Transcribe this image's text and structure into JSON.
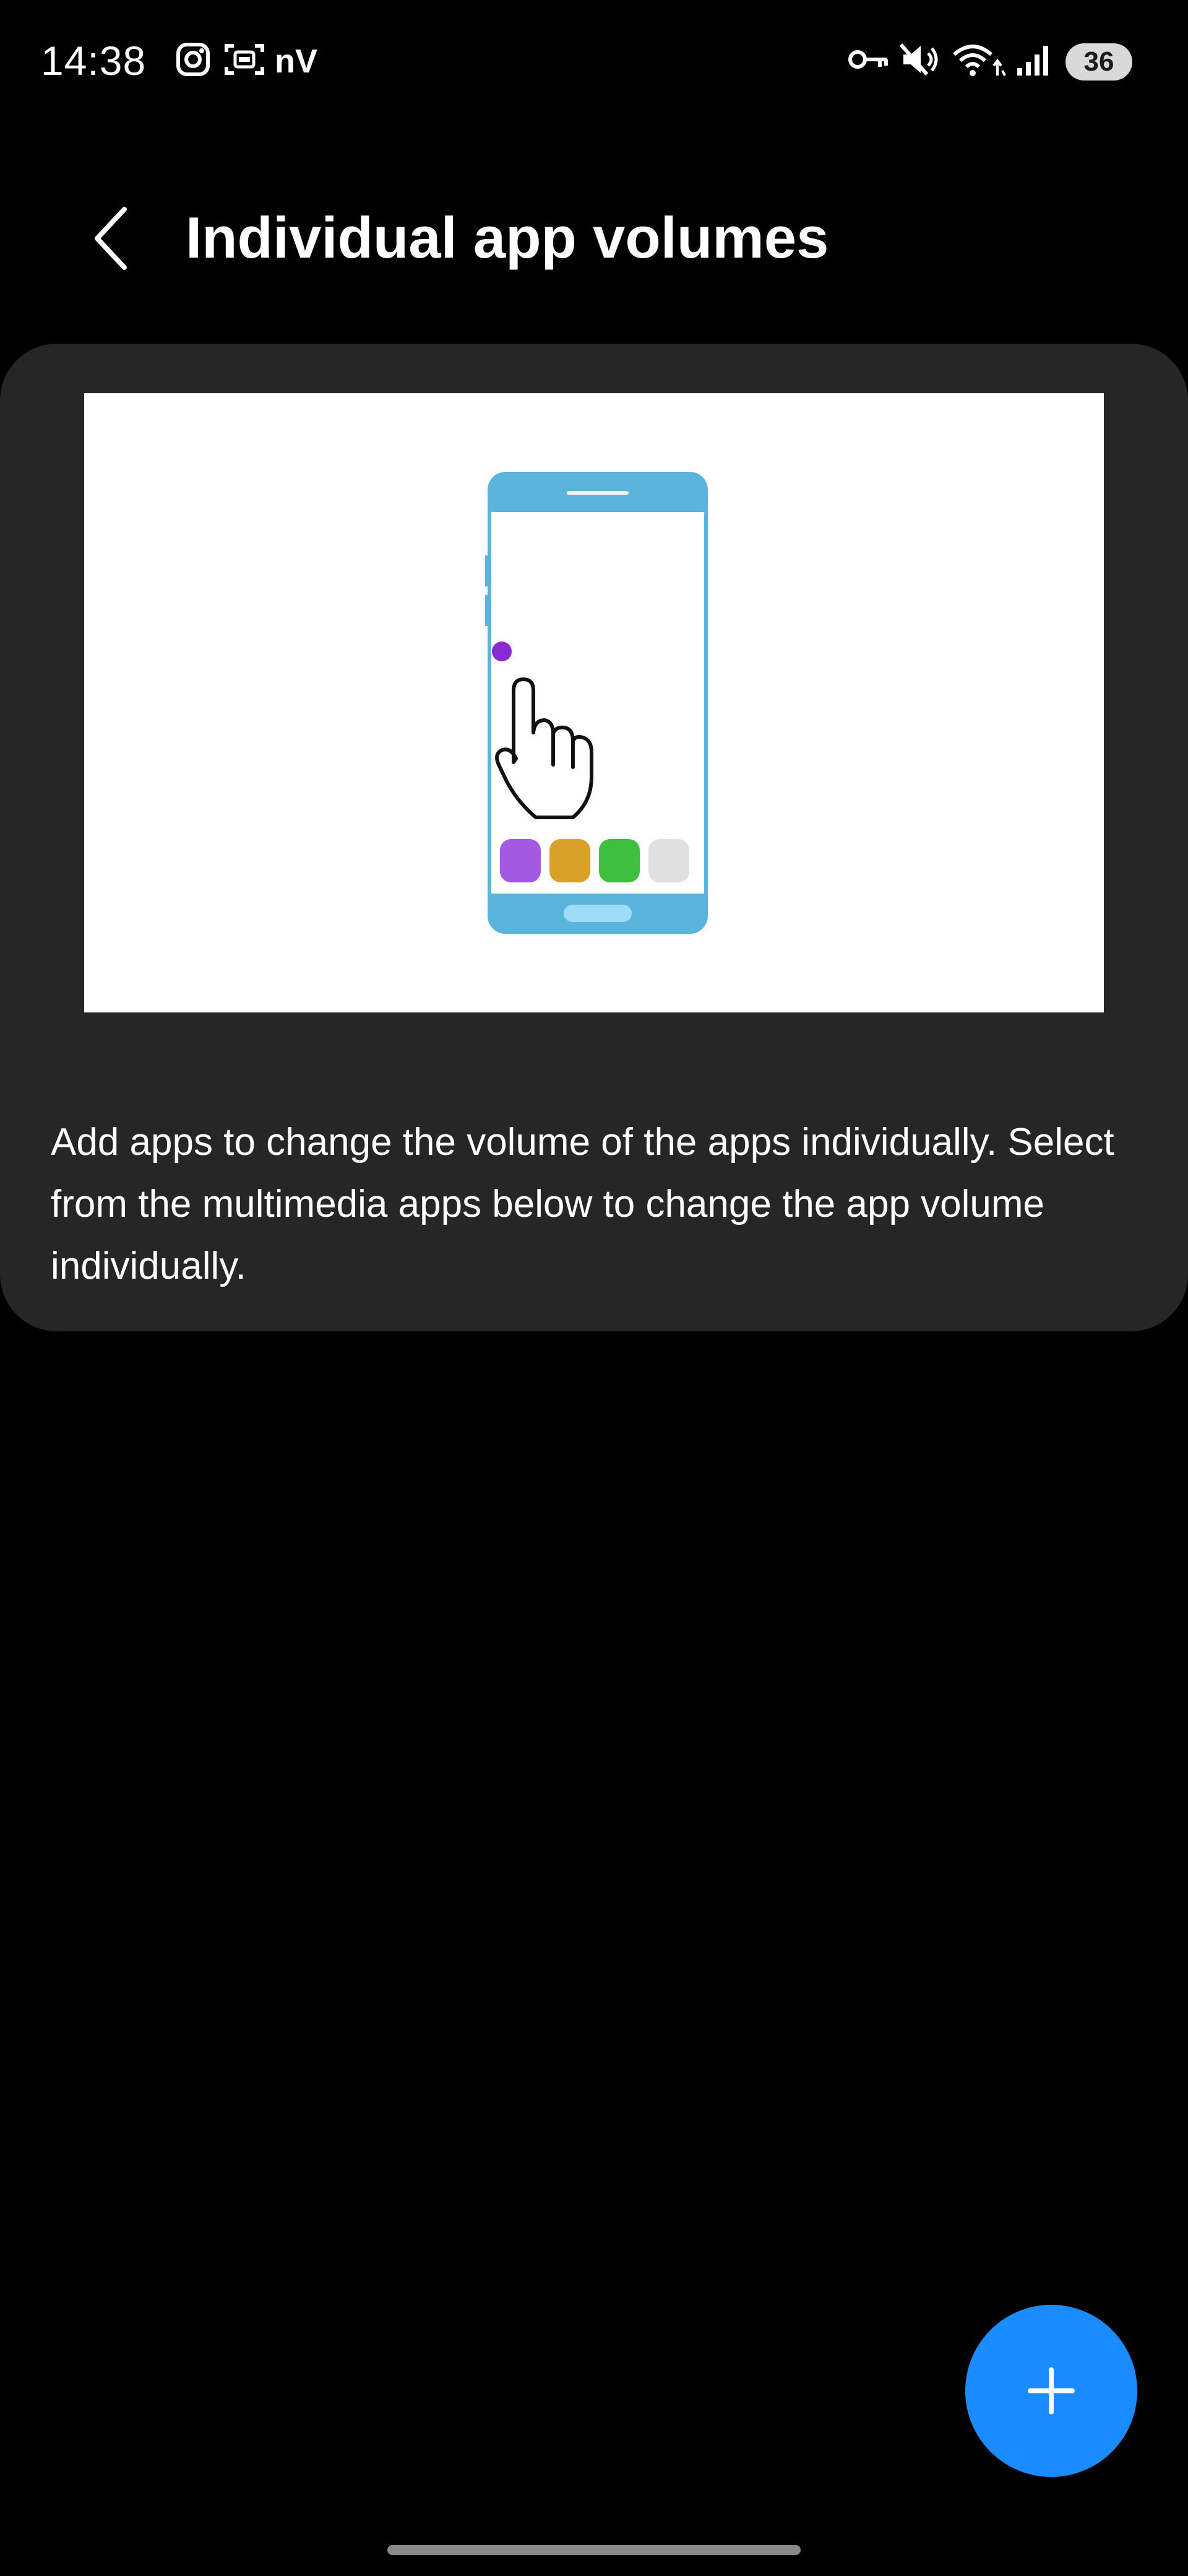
{
  "status_bar": {
    "time": "14:38",
    "carrier_text": "nV",
    "battery_level": "36",
    "icons": [
      "instagram-icon",
      "screen-recorder-icon",
      "vpn-key-icon",
      "mute-icon",
      "wifi-icon",
      "signal-icon"
    ]
  },
  "header": {
    "title": "Individual app volumes"
  },
  "card": {
    "description": "Add apps to change the volume of the apps individually. Select from the multimedia apps below to change the app volume individually.",
    "illustration": {
      "icons": [
        "phone-illustration",
        "hand-pointer-icon"
      ],
      "colors": {
        "phone_frame": "#5ab4dc",
        "dot": "#8a2bd2",
        "app1": "#a35ae0",
        "app2": "#d9a02a",
        "app3": "#3fbf3f",
        "app4": "#e0e0e0"
      }
    }
  },
  "fab": {
    "icon": "plus-icon",
    "color": "#1a8cff"
  },
  "colors": {
    "background": "#000000",
    "card": "#262626",
    "accent": "#1a8cff"
  }
}
